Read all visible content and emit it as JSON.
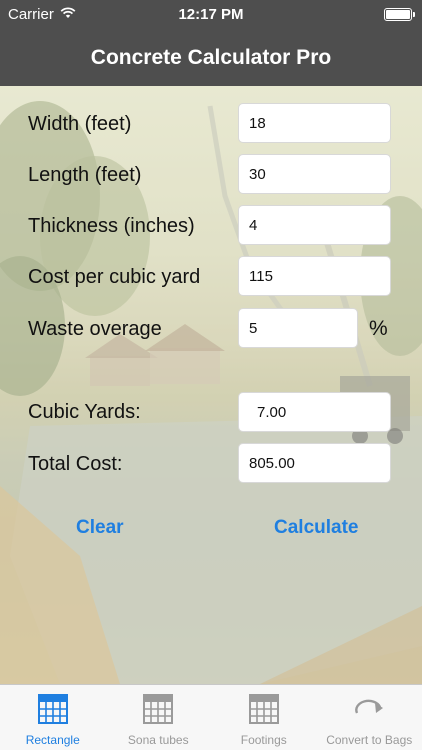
{
  "status_bar": {
    "carrier": "Carrier",
    "time": "12:17 PM"
  },
  "nav": {
    "title": "Concrete Calculator Pro"
  },
  "form": {
    "width_label": "Width (feet)",
    "width_value": "18",
    "length_label": "Length (feet)",
    "length_value": "30",
    "thickness_label": "Thickness (inches)",
    "thickness_value": "4",
    "cost_label": "Cost per cubic yard",
    "cost_value": "115",
    "waste_label": "Waste overage",
    "waste_value": "5",
    "waste_unit": "%"
  },
  "results": {
    "cubic_yards_label": "Cubic Yards:",
    "cubic_yards_value": "7.00",
    "total_cost_label": "Total Cost:",
    "total_cost_value": "805.00"
  },
  "actions": {
    "clear": "Clear",
    "calculate": "Calculate"
  },
  "tabs": [
    {
      "label": "Rectangle",
      "icon": "grid-icon",
      "active": true
    },
    {
      "label": "Sona tubes",
      "icon": "grid-icon",
      "active": false
    },
    {
      "label": "Footings",
      "icon": "grid-icon",
      "active": false
    },
    {
      "label": "Convert to Bags",
      "icon": "refresh-arrow-icon",
      "active": false
    }
  ],
  "colors": {
    "accent": "#1f7fe0",
    "bar": "#4e4e4e",
    "inactive_tab": "#999999"
  }
}
